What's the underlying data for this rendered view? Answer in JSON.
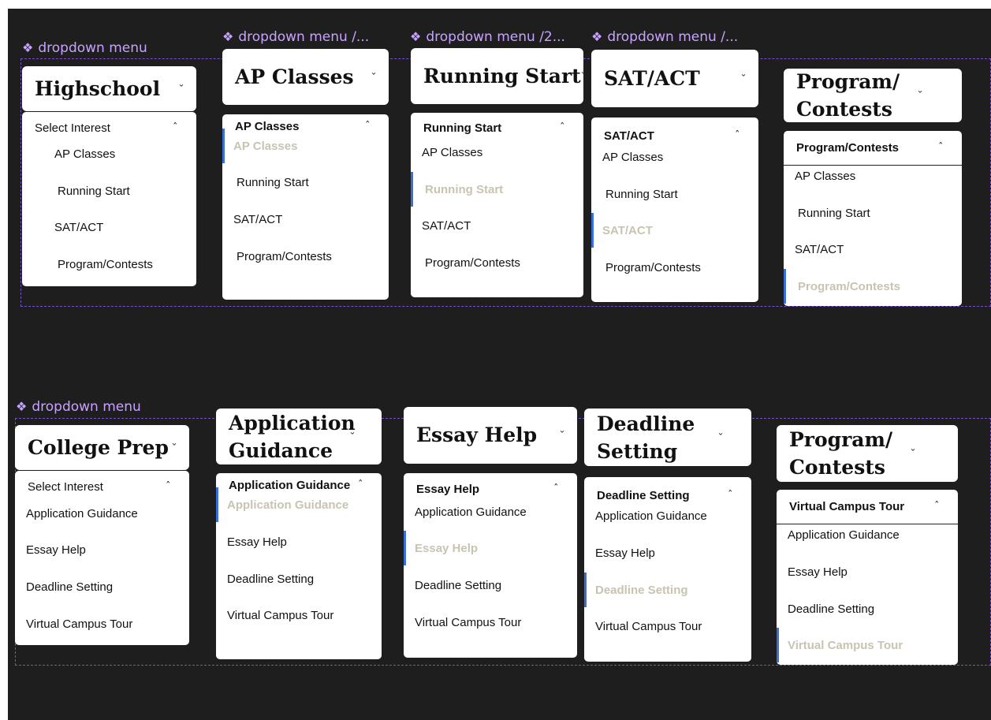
{
  "rows": [
    {
      "labels": [
        "dropdown menu",
        "dropdown menu /...",
        "dropdown menu /2...",
        "dropdown menu /..."
      ],
      "variants": [
        {
          "trigger": "Highschool",
          "header": "Select Interest",
          "header_bold": false,
          "items": [
            "AP Classes",
            "Running Start",
            "SAT/ACT",
            "Program/Contests"
          ],
          "selected": -1
        },
        {
          "trigger": "AP Classes",
          "header": "AP Classes",
          "header_bold": true,
          "items": [
            "AP Classes",
            "Running Start",
            "SAT/ACT",
            "Program/Contests"
          ],
          "selected": 0
        },
        {
          "trigger": "Running Start",
          "header": "Running Start",
          "header_bold": true,
          "items": [
            "AP Classes",
            "Running Start",
            "SAT/ACT",
            "Program/Contests"
          ],
          "selected": 1
        },
        {
          "trigger": "SAT/ACT",
          "header": "SAT/ACT",
          "header_bold": true,
          "items": [
            "AP Classes",
            "Running Start",
            "SAT/ACT",
            "Program/Contests"
          ],
          "selected": 2
        },
        {
          "trigger": "Program/ Contests",
          "header": "Program/Contests",
          "header_bold": true,
          "items": [
            "AP Classes",
            "Running Start",
            "SAT/ACT",
            "Program/Contests"
          ],
          "selected": 3
        }
      ]
    },
    {
      "labels": [
        "dropdown menu"
      ],
      "variants": [
        {
          "trigger": "College Prep",
          "header": "Select Interest",
          "header_bold": false,
          "items": [
            "Application Guidance",
            "Essay Help",
            "Deadline Setting",
            "Virtual Campus Tour"
          ],
          "selected": -1
        },
        {
          "trigger": "Application Guidance",
          "header": "Application Guidance",
          "header_bold": true,
          "items": [
            "Application Guidance",
            "Essay Help",
            "Deadline Setting",
            "Virtual Campus Tour"
          ],
          "selected": 0
        },
        {
          "trigger": "Essay Help",
          "header": "Essay Help",
          "header_bold": true,
          "items": [
            "Application Guidance",
            "Essay Help",
            "Deadline Setting",
            "Virtual Campus Tour"
          ],
          "selected": 1
        },
        {
          "trigger": "Deadline Setting",
          "header": "Deadline Setting",
          "header_bold": true,
          "items": [
            "Application Guidance",
            "Essay Help",
            "Deadline Setting",
            "Virtual Campus Tour"
          ],
          "selected": 2
        },
        {
          "trigger": "Program/ Contests",
          "header": "Virtual Campus Tour",
          "header_bold": true,
          "items": [
            "Application Guidance",
            "Essay Help",
            "Deadline Setting",
            "Virtual Campus Tour"
          ],
          "selected": 3
        }
      ]
    }
  ],
  "colors": {
    "canvas_bg": "#1e1e1f",
    "component_label": "#c7a3ff",
    "set_border": "#7b4fc9",
    "selected_text": "#c8c4b2",
    "selected_bar": "#3b6fd8"
  },
  "icons": {
    "label_icon": "component-diamond-icon",
    "trigger_icon": "chevron-down-icon",
    "panel_icon": "chevron-up-icon"
  }
}
